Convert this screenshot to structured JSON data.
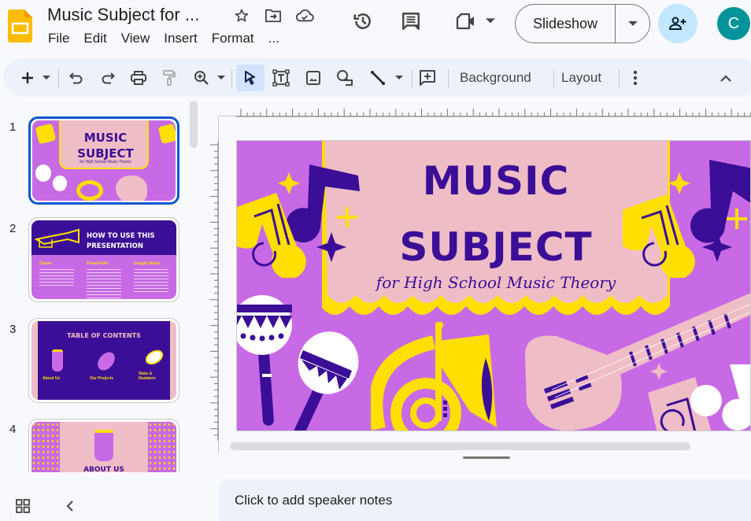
{
  "header": {
    "doc_title": "Music Subject for ...",
    "menu": [
      "File",
      "Edit",
      "View",
      "Insert",
      "Format",
      "..."
    ],
    "slideshow_label": "Slideshow",
    "avatar_initial": "C"
  },
  "toolbar": {
    "background_label": "Background",
    "layout_label": "Layout"
  },
  "filmstrip": {
    "slides": [
      {
        "number": "1",
        "title": "MUSIC SUBJECT",
        "subtitle": "for High School Music Theory"
      },
      {
        "number": "2",
        "title": "HOW TO USE THIS PRESENTATION",
        "columns": [
          "Canva",
          "PowerPoint",
          "Google Slides"
        ]
      },
      {
        "number": "3",
        "title": "TABLE OF CONTENTS",
        "items": [
          "About Us",
          "Our Projects",
          "Stats & Numbers"
        ]
      },
      {
        "number": "4",
        "title": "ABOUT US"
      }
    ]
  },
  "slide": {
    "title_line1": "MUSIC",
    "title_line2": "SUBJECT",
    "subtitle": "for High School Music Theory",
    "colors": {
      "purple": "#c86ae6",
      "pink": "#efbdc6",
      "yellow": "#ffdf00",
      "indigo": "#3a0e96"
    }
  },
  "notes": {
    "placeholder": "Click to add speaker notes"
  }
}
